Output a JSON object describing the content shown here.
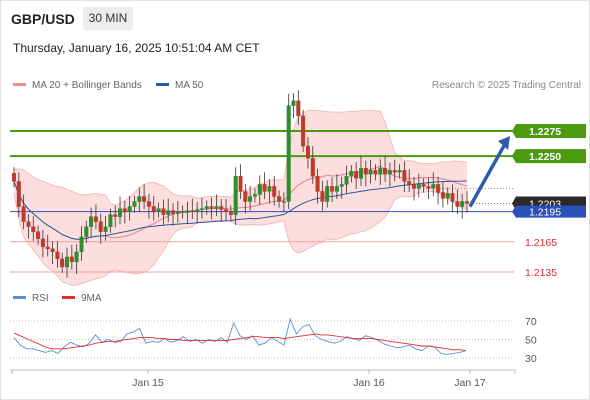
{
  "header": {
    "symbol": "GBP/USD",
    "timeframe": "30 MIN",
    "datetime": "Thursday, January 16, 2025 10:51:04 AM CET",
    "credit": "Research © 2025 Trading Central"
  },
  "legend_price": [
    {
      "name": "MA 20 + Bollinger Bands",
      "color": "#f28b8b"
    },
    {
      "name": "MA 50",
      "color": "#2d5a9e"
    }
  ],
  "legend_rsi": [
    {
      "name": "RSI",
      "color": "#5a8fd6"
    },
    {
      "name": "9MA",
      "color": "#e03030"
    }
  ],
  "colors": {
    "up": "#2e8b2e",
    "down": "#c0392b",
    "resistance": "#4c9a10",
    "current": "#2b50b8",
    "support": "#f0a0a0",
    "arrow": "#2d5ca8",
    "grid": "#cccccc"
  },
  "chart_data": [
    {
      "type": "candlestick",
      "symbol": "GBP/USD",
      "timeframe": "30 MIN",
      "x_ticks": [
        "Jan 15",
        "Jan 16",
        "Jan 17"
      ],
      "ylim": [
        1.212,
        1.233
      ],
      "current_price": 1.2195,
      "last_close": 1.2203,
      "levels": [
        {
          "value": 1.2275,
          "label": "1.2275",
          "kind": "resistance"
        },
        {
          "value": 1.225,
          "label": "1.2250",
          "kind": "resistance"
        },
        {
          "value": 1.2195,
          "label": "1.2195",
          "kind": "current"
        },
        {
          "value": 1.2165,
          "label": "1.2165",
          "kind": "support"
        },
        {
          "value": 1.2135,
          "label": "1.2135",
          "kind": "support"
        }
      ],
      "close_label": "1.2203",
      "arrow": {
        "from": 1.22,
        "to": 1.227,
        "direction": "up"
      },
      "closes": [
        1.2225,
        1.22,
        1.2185,
        1.218,
        1.2175,
        1.2168,
        1.216,
        1.2158,
        1.2155,
        1.2148,
        1.214,
        1.215,
        1.2145,
        1.2155,
        1.217,
        1.218,
        1.219,
        1.2185,
        1.2175,
        1.218,
        1.2192,
        1.219,
        1.2198,
        1.2195,
        1.22,
        1.2205,
        1.221,
        1.2205,
        1.22,
        1.2195,
        1.2198,
        1.2192,
        1.2196,
        1.2193,
        1.2195,
        1.2194,
        1.2196,
        1.2195,
        1.2197,
        1.2198,
        1.22,
        1.2198,
        1.22,
        1.2197,
        1.2195,
        1.2192,
        1.223,
        1.2215,
        1.2205,
        1.221,
        1.2212,
        1.2222,
        1.2215,
        1.222,
        1.221,
        1.2205,
        1.2205,
        1.23,
        1.2305,
        1.229,
        1.226,
        1.2248,
        1.223,
        1.2215,
        1.2205,
        1.222,
        1.2215,
        1.222,
        1.2222,
        1.223,
        1.2235,
        1.2228,
        1.2238,
        1.2232,
        1.2236,
        1.2232,
        1.2238,
        1.2232,
        1.2236,
        1.2234,
        1.2236,
        1.2225,
        1.2222,
        1.2218,
        1.2222,
        1.222,
        1.2218,
        1.2222,
        1.2214,
        1.2208,
        1.2213,
        1.2205,
        1.22,
        1.2205,
        1.2203
      ]
    },
    {
      "type": "line",
      "name": "RSI",
      "yticks": [
        70,
        50,
        30
      ],
      "ylim": [
        22,
        78
      ],
      "series": [
        {
          "name": "RSI",
          "values": [
            52,
            44,
            40,
            40,
            38,
            36,
            38,
            35,
            42,
            47,
            44,
            42,
            46,
            55,
            47,
            50,
            47,
            48,
            56,
            58,
            62,
            46,
            48,
            47,
            51,
            47,
            49,
            53,
            48,
            50,
            46,
            50,
            48,
            52,
            47,
            68,
            54,
            50,
            54,
            44,
            46,
            52,
            48,
            44,
            72,
            56,
            64,
            66,
            54,
            50,
            48,
            46,
            48,
            53,
            51,
            49,
            54,
            52,
            49,
            45,
            43,
            41,
            42,
            44,
            40,
            38,
            43,
            42,
            35,
            34,
            35,
            36,
            38
          ]
        },
        {
          "name": "9MA",
          "values": [
            57,
            54,
            51,
            48,
            45,
            42,
            40,
            40,
            40,
            41,
            42,
            43,
            44,
            46,
            47,
            48,
            48,
            49,
            50,
            51,
            52,
            52,
            52,
            51,
            51,
            50,
            50,
            49,
            49,
            49,
            49,
            49,
            49,
            49,
            49,
            50,
            51,
            52,
            53,
            53,
            52,
            52,
            52,
            51,
            52,
            53,
            54,
            55,
            56,
            55,
            55,
            54,
            53,
            52,
            51,
            51,
            51,
            51,
            50,
            49,
            48,
            47,
            46,
            45,
            44,
            43,
            43,
            42,
            41,
            40,
            39,
            39,
            38
          ]
        }
      ]
    }
  ]
}
